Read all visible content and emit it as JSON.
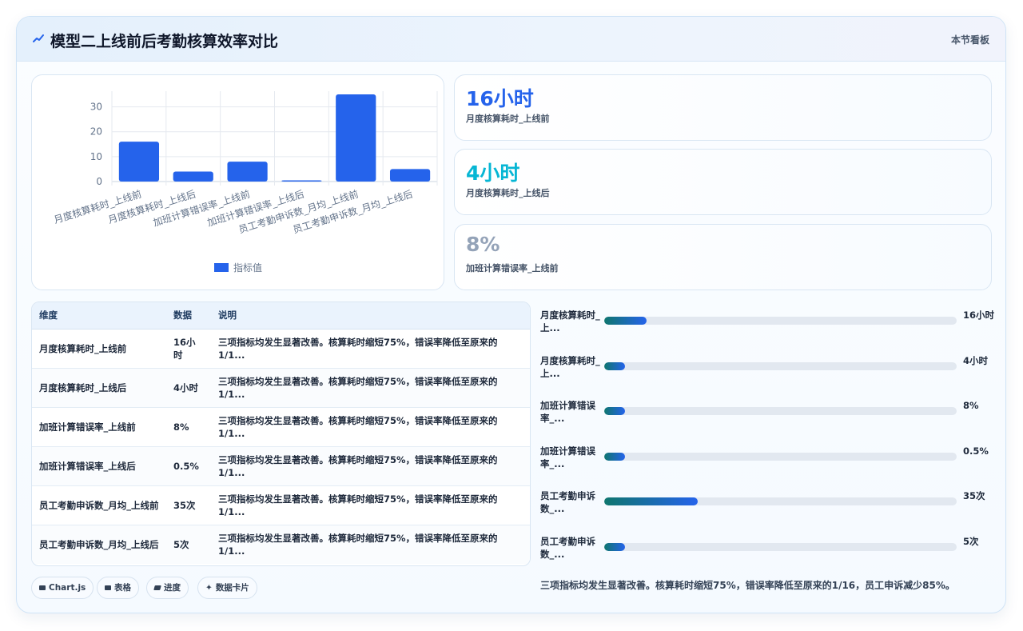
{
  "header": {
    "title": "模型二上线前后考勤核算效率对比",
    "right_label": "本节看板"
  },
  "colors": {
    "bar": "#2563eb",
    "accent_blue": "#2563eb",
    "accent_cyan": "#06b6d4",
    "muted": "#94a3b8",
    "progress_start": "#0f766e",
    "progress_end": "#2563eb"
  },
  "chart_data": {
    "type": "bar",
    "categories": [
      "月度核算耗时_上线前",
      "月度核算耗时_上线后",
      "加班计算错误率_上线前",
      "加班计算错误率_上线后",
      "员工考勤申诉数_月均_上线前",
      "员工考勤申诉数_月均_上线后"
    ],
    "series": [
      {
        "name": "指标值",
        "values": [
          16,
          4,
          8,
          0.5,
          35,
          5
        ]
      }
    ],
    "ylim": [
      0,
      35
    ],
    "yticks": [
      0,
      10,
      20,
      30
    ],
    "grid": true,
    "legend": "bottom"
  },
  "stats": [
    {
      "value": "16小时",
      "label": "月度核算耗时_上线前",
      "color": "#2563eb"
    },
    {
      "value": "4小时",
      "label": "月度核算耗时_上线后",
      "color": "#06b6d4"
    },
    {
      "value": "8%",
      "label": "加班计算错误率_上线前",
      "color": "#94a3b8"
    }
  ],
  "table": {
    "headers": [
      "维度",
      "数据",
      "说明"
    ],
    "rows": [
      {
        "dim": "月度核算耗时_上线前",
        "data": "16小时",
        "desc": "三项指标均发生显著改善。核算耗时缩短75%，错误率降低至原来的1/1..."
      },
      {
        "dim": "月度核算耗时_上线后",
        "data": "4小时",
        "desc": "三项指标均发生显著改善。核算耗时缩短75%，错误率降低至原来的1/1..."
      },
      {
        "dim": "加班计算错误率_上线前",
        "data": "8%",
        "desc": "三项指标均发生显著改善。核算耗时缩短75%，错误率降低至原来的1/1..."
      },
      {
        "dim": "加班计算错误率_上线后",
        "data": "0.5%",
        "desc": "三项指标均发生显著改善。核算耗时缩短75%，错误率降低至原来的1/1..."
      },
      {
        "dim": "员工考勤申诉数_月均_上线前",
        "data": "35次",
        "desc": "三项指标均发生显著改善。核算耗时缩短75%，错误率降低至原来的1/1..."
      },
      {
        "dim": "员工考勤申诉数_月均_上线后",
        "data": "5次",
        "desc": "三项指标均发生显著改善。核算耗时缩短75%，错误率降低至原来的1/1..."
      }
    ]
  },
  "progress": [
    {
      "label": "月度核算耗时_上...",
      "value": "16小时",
      "fill": 0.12
    },
    {
      "label": "月度核算耗时_上...",
      "value": "4小时",
      "fill": 0.06
    },
    {
      "label": "加班计算错误率_...",
      "value": "8%",
      "fill": 0.06
    },
    {
      "label": "加班计算错误率_...",
      "value": "0.5%",
      "fill": 0.06
    },
    {
      "label": "员工考勤申诉数_...",
      "value": "35次",
      "fill": 0.265
    },
    {
      "label": "员工考勤申诉数_...",
      "value": "5次",
      "fill": 0.06
    }
  ],
  "summary": "三项指标均发生显著改善。核算耗时缩短75%，错误率降低至原来的1/16，员工申诉减少85%。",
  "chips": [
    {
      "icon": "chart-icon",
      "label": "Chart.js"
    },
    {
      "icon": "table-icon",
      "label": "表格"
    },
    {
      "icon": "progress-icon",
      "label": "进度"
    },
    {
      "icon": "sparkle-icon",
      "label": "数据卡片"
    }
  ]
}
